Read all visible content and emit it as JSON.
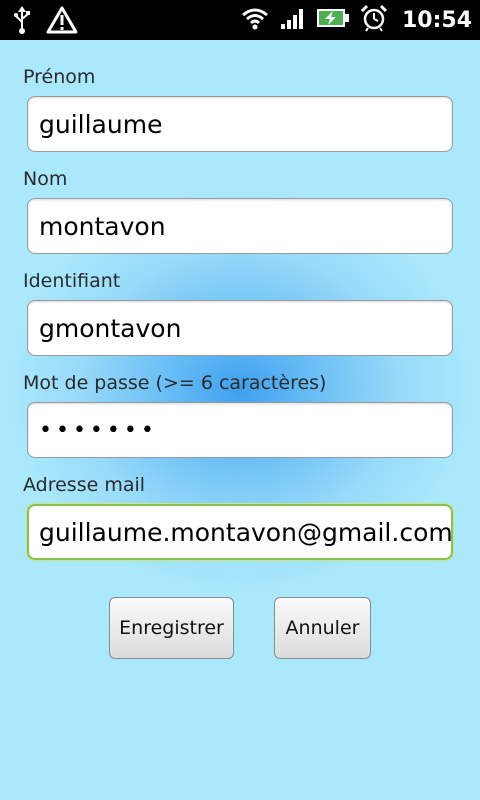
{
  "statusbar": {
    "time": "10:54",
    "icons": [
      "usb-icon",
      "warning-icon",
      "wifi-icon",
      "signal-icon",
      "battery-charging-icon",
      "alarm-icon"
    ]
  },
  "form": {
    "firstname": {
      "label": "Prénom",
      "value": "guillaume"
    },
    "lastname": {
      "label": "Nom",
      "value": "montavon"
    },
    "username": {
      "label": "Identifiant",
      "value": "gmontavon"
    },
    "password": {
      "label": "Mot de passe (>= 6 caractères)",
      "value": "•••••••"
    },
    "email": {
      "label": "Adresse mail",
      "value": "guillaume.montavon@gmail.com"
    }
  },
  "buttons": {
    "save": "Enregistrer",
    "cancel": "Annuler"
  },
  "colors": {
    "background": "#a9e8fd",
    "glow": "#3ea0ee",
    "focus_border": "#8bc34a",
    "battery": "#4caf50"
  }
}
